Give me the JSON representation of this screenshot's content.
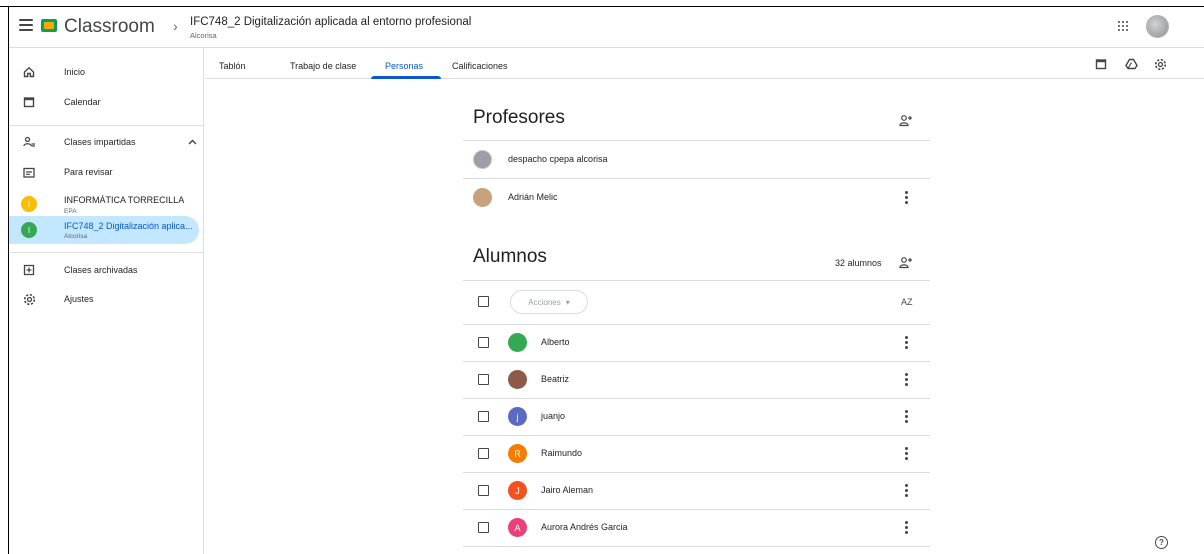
{
  "app": {
    "brand": "Classroom",
    "breadcrumb_separator": "›",
    "class_title": "IFC748_2 Digitalización aplicada al entorno profesional",
    "class_subtitle": "Alcorisa"
  },
  "icons": {
    "menu": "hamburger-menu-icon",
    "apps": "apps-grid-icon",
    "calendar": "calendar-icon",
    "drive": "drive-icon",
    "settings": "gear-icon",
    "help": "help-icon",
    "add_person": "add-person-icon",
    "sort": "sort-az-icon"
  },
  "sidebar": {
    "items": [
      {
        "label": "Inicio"
      },
      {
        "label": "Calendar"
      },
      {
        "label": "Clases impartidas"
      },
      {
        "label": "Para revisar"
      },
      {
        "label": "INFORMÁTICA TORRECILLA",
        "sub": "EPA",
        "badge": "I"
      },
      {
        "label": "IFC748_2 Digitalización aplica...",
        "sub": "Alcorisa",
        "badge": "I"
      },
      {
        "label": "Clases archivadas"
      },
      {
        "label": "Ajustes"
      }
    ]
  },
  "tabs": [
    {
      "label": "Tablón"
    },
    {
      "label": "Trabajo de clase"
    },
    {
      "label": "Personas",
      "active": true
    },
    {
      "label": "Calificaciones"
    }
  ],
  "teachers": {
    "title": "Profesores",
    "people": [
      {
        "name": "despacho cpepa alcorisa"
      },
      {
        "name": "Adrián Melic"
      }
    ]
  },
  "students": {
    "title": "Alumnos",
    "count_label": "32 alumnos",
    "actions_label": "Acciones",
    "actions_caret": "▾",
    "sort_label": "AZ",
    "people": [
      {
        "name": "Alberto",
        "initial": "",
        "color": "#34a853"
      },
      {
        "name": "Beatriz",
        "initial": "",
        "color": "#8d5a4a"
      },
      {
        "name": "juanjo",
        "initial": "j",
        "color": "#5c6bc0"
      },
      {
        "name": "Raimundo",
        "initial": "R",
        "color": "#f57c00"
      },
      {
        "name": "Jairo Aleman",
        "initial": "J",
        "color": "#f4511e"
      },
      {
        "name": "Aurora Andrés Garcia",
        "initial": "A",
        "color": "#ec407a"
      }
    ]
  },
  "help": {
    "label": "?"
  }
}
